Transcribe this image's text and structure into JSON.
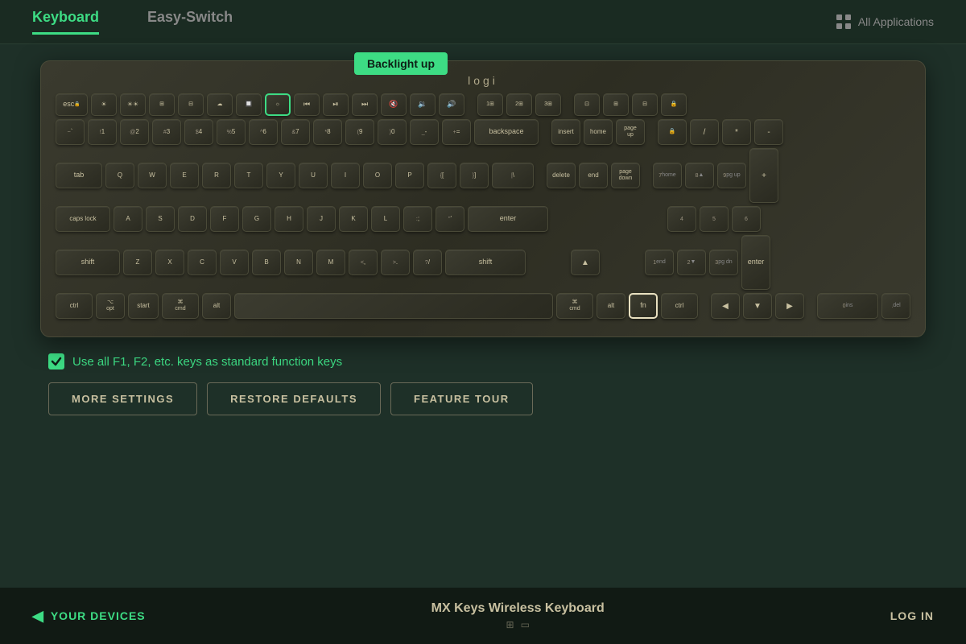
{
  "nav": {
    "tab_keyboard": "Keyboard",
    "tab_easyswitch": "Easy-Switch",
    "all_applications": "All Applications"
  },
  "tooltip": {
    "text": "Backlight up"
  },
  "keyboard": {
    "logo": "logi"
  },
  "checkbox": {
    "label": "Use all F1, F2, etc. keys as standard function keys"
  },
  "buttons": {
    "more_settings": "MORE SETTINGS",
    "restore_defaults": "RESTORE DEFAULTS",
    "feature_tour": "FEATURE TOUR"
  },
  "bottom": {
    "your_devices": "YOUR DEVICES",
    "device_name": "MX Keys Wireless Keyboard",
    "log_in": "LOG IN"
  }
}
